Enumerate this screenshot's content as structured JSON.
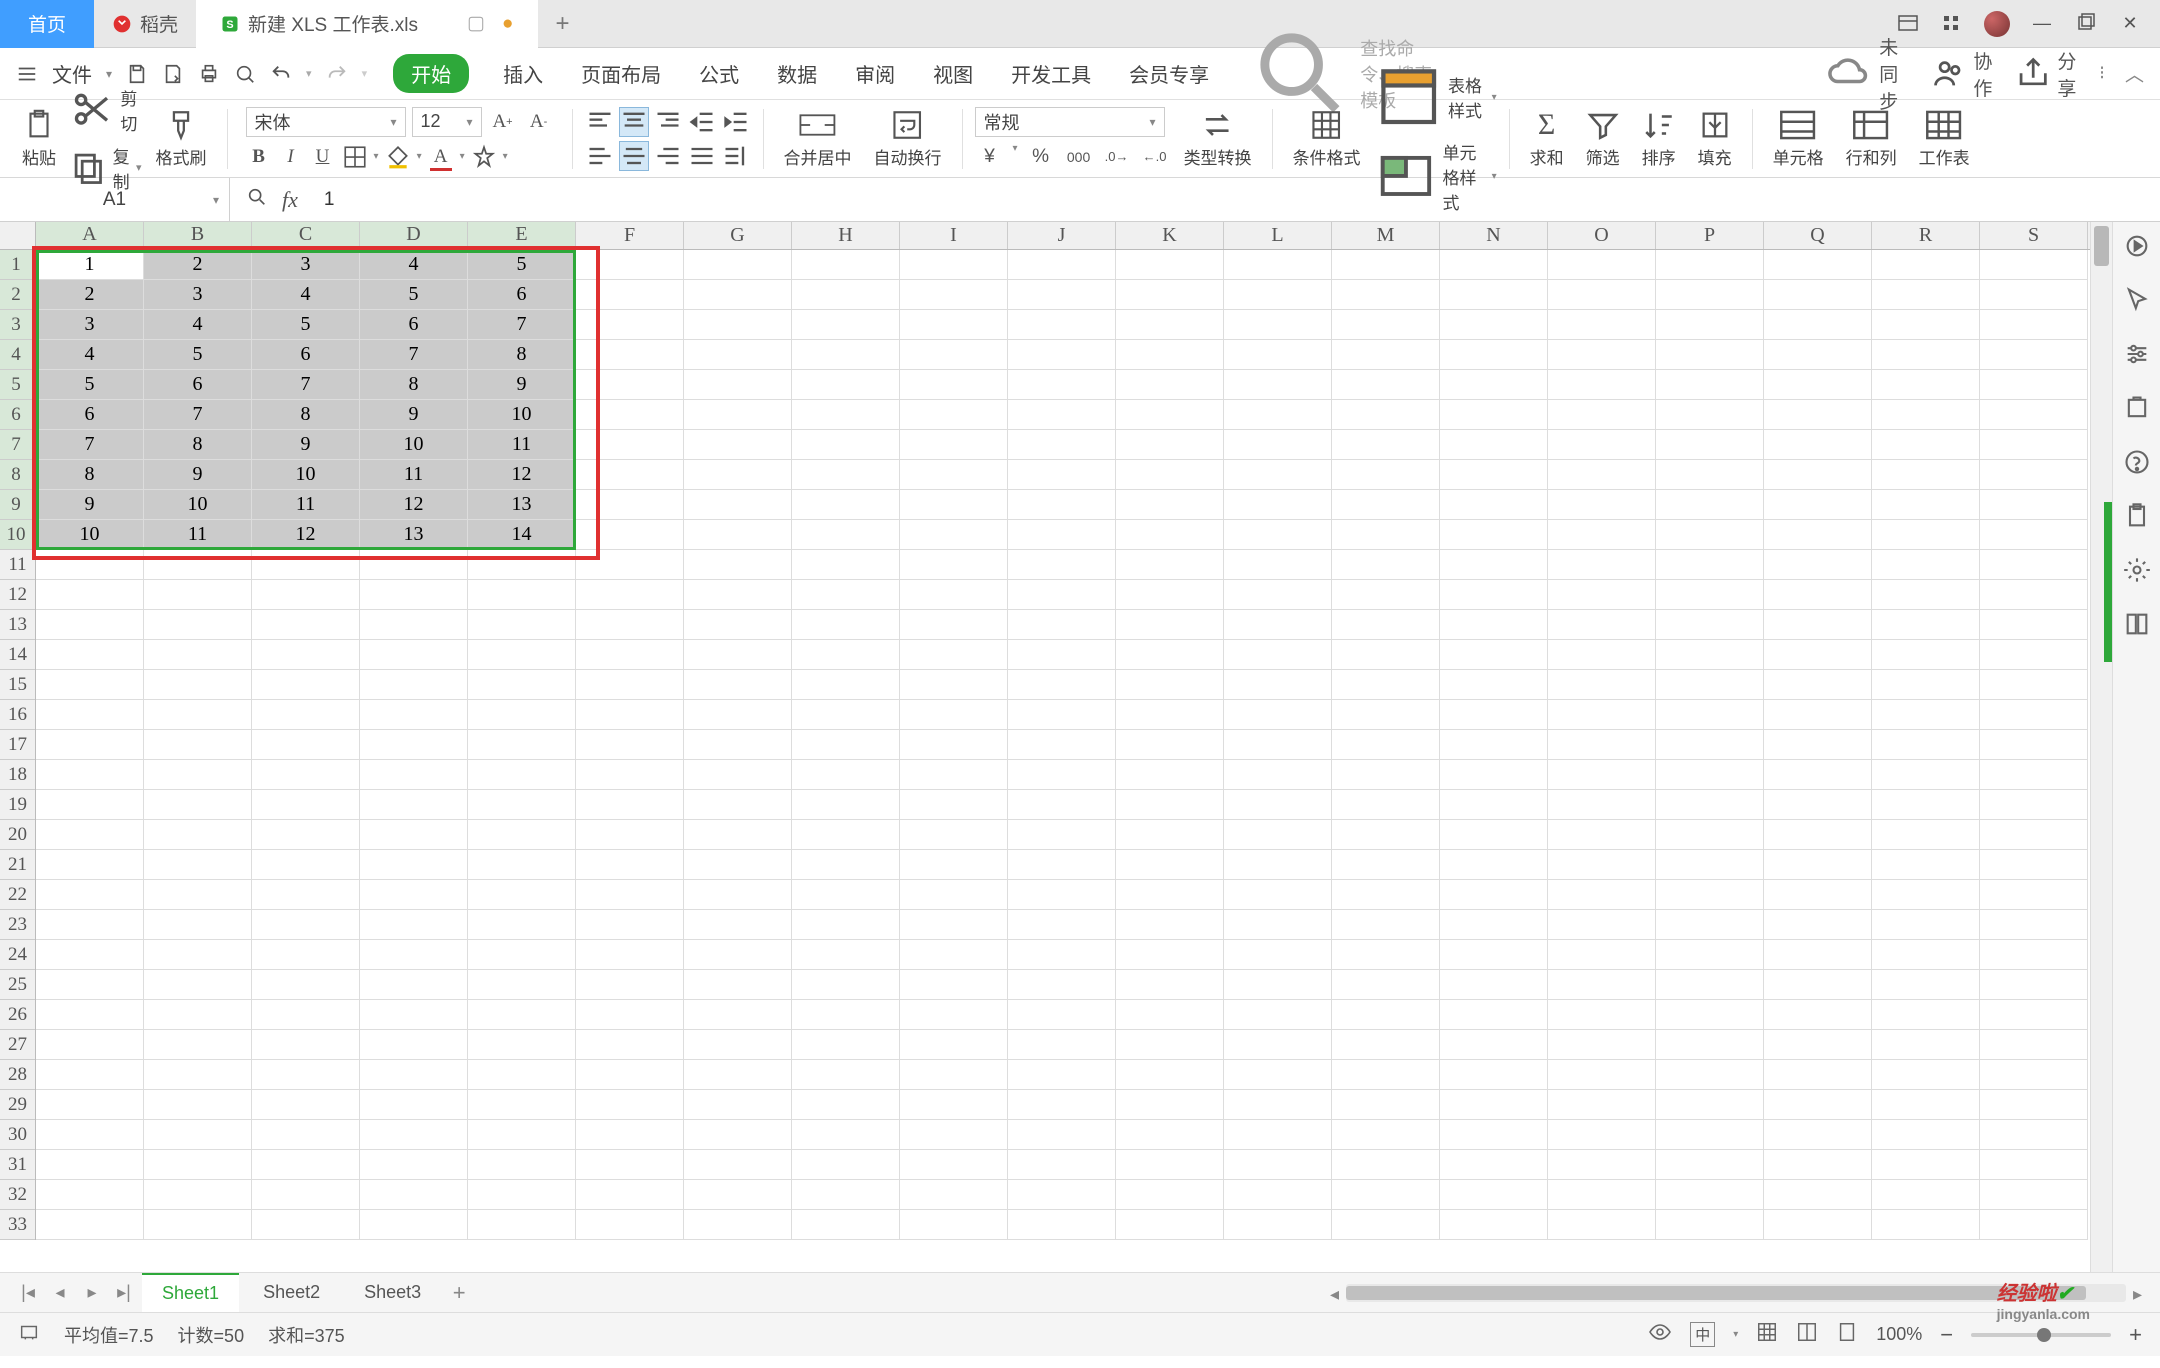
{
  "tabs": {
    "home": "首页",
    "docke": "稻壳",
    "doc": "新建 XLS 工作表.xls",
    "add": "+"
  },
  "menu": {
    "file": "文件",
    "start": "开始",
    "insert": "插入",
    "layout": "页面布局",
    "formula": "公式",
    "data": "数据",
    "review": "审阅",
    "view": "视图",
    "dev": "开发工具",
    "member": "会员专享"
  },
  "search_placeholder": "查找命令、搜索模板",
  "sync": "未同步",
  "collab": "协作",
  "share": "分享",
  "ribbon": {
    "paste": "粘贴",
    "cut": "剪切",
    "copy": "复制",
    "format_painter": "格式刷",
    "font_name": "宋体",
    "font_size": "12",
    "merge": "合并居中",
    "wrap": "自动换行",
    "number_format": "常规",
    "type_convert": "类型转换",
    "cond_fmt": "条件格式",
    "table_style": "表格样式",
    "cell_style": "单元格样式",
    "sum": "求和",
    "filter": "筛选",
    "sort": "排序",
    "fill": "填充",
    "cell": "单元格",
    "rowcol": "行和列",
    "sheet": "工作表"
  },
  "name_box": "A1",
  "fx_value": "1",
  "columns": [
    "A",
    "B",
    "C",
    "D",
    "E",
    "F",
    "G",
    "H",
    "I",
    "J",
    "K",
    "L",
    "M",
    "N",
    "O",
    "P",
    "Q",
    "R",
    "S"
  ],
  "rows": [
    "1",
    "2",
    "3",
    "4",
    "5",
    "6",
    "7",
    "8",
    "9",
    "10",
    "11",
    "12",
    "13",
    "14",
    "15",
    "16",
    "17",
    "18",
    "19",
    "20",
    "21",
    "22",
    "23",
    "24",
    "25",
    "26",
    "27",
    "28",
    "29",
    "30",
    "31",
    "32",
    "33"
  ],
  "chart_data": {
    "type": "table",
    "selection": "A1:E10",
    "values": [
      [
        1,
        2,
        3,
        4,
        5
      ],
      [
        2,
        3,
        4,
        5,
        6
      ],
      [
        3,
        4,
        5,
        6,
        7
      ],
      [
        4,
        5,
        6,
        7,
        8
      ],
      [
        5,
        6,
        7,
        8,
        9
      ],
      [
        6,
        7,
        8,
        9,
        10
      ],
      [
        7,
        8,
        9,
        10,
        11
      ],
      [
        8,
        9,
        10,
        11,
        12
      ],
      [
        9,
        10,
        11,
        12,
        13
      ],
      [
        10,
        11,
        12,
        13,
        14
      ]
    ]
  },
  "sheets": [
    "Sheet1",
    "Sheet2",
    "Sheet3"
  ],
  "status": {
    "avg": "平均值=7.5",
    "count": "计数=50",
    "sum": "求和=375"
  },
  "zoom": "100%",
  "watermark": {
    "main": "经验啦",
    "sub": "jingyanla.com"
  }
}
